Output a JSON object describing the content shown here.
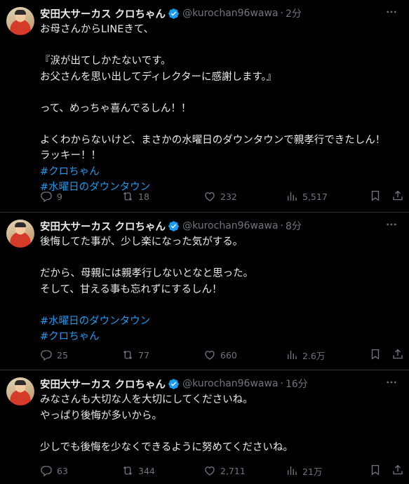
{
  "tweets": [
    {
      "author": "安田大サーカス クロちゃん",
      "handle": "@kurochan96wawa",
      "separator": "·",
      "time": "2分",
      "lines": [
        {
          "text": "お母さんからLINEきて、",
          "type": "text"
        },
        {
          "text": "",
          "type": "blank"
        },
        {
          "text": "『涙が出てしかたないです。",
          "type": "text"
        },
        {
          "text": "お父さんを思い出してディレクターに感謝します。』",
          "type": "text"
        },
        {
          "text": "",
          "type": "blank"
        },
        {
          "text": "って、めっちゃ喜んでるしん！！",
          "type": "text"
        },
        {
          "text": "",
          "type": "blank"
        },
        {
          "text": "よくわからないけど、まさかの水曜日のダウンタウンで親孝行できたしん！",
          "type": "text"
        },
        {
          "text": "ラッキー！！",
          "type": "text"
        },
        {
          "text": "#クロちゃん",
          "type": "hashtag"
        },
        {
          "text": "#水曜日のダウンタウン",
          "type": "hashtag"
        }
      ],
      "replies": "9",
      "retweets": "18",
      "likes": "232",
      "views": "5,517"
    },
    {
      "author": "安田大サーカス クロちゃん",
      "handle": "@kurochan96wawa",
      "separator": "·",
      "time": "8分",
      "lines": [
        {
          "text": "後悔してた事が、少し楽になった気がする。",
          "type": "text"
        },
        {
          "text": "",
          "type": "blank"
        },
        {
          "text": "だから、母親には親孝行しないとなと思った。",
          "type": "text"
        },
        {
          "text": "そして、甘える事も忘れずにするしん！",
          "type": "text"
        },
        {
          "text": "",
          "type": "blank"
        },
        {
          "text": "#水曜日のダウンタウン",
          "type": "hashtag"
        },
        {
          "text": "#クロちゃん",
          "type": "hashtag"
        }
      ],
      "replies": "25",
      "retweets": "77",
      "likes": "660",
      "views": "2.6万"
    },
    {
      "author": "安田大サーカス クロちゃん",
      "handle": "@kurochan96wawa",
      "separator": "·",
      "time": "16分",
      "lines": [
        {
          "text": "みなさんも大切な人を大切にしてくださいね。",
          "type": "text"
        },
        {
          "text": "やっぱり後悔が多いから。",
          "type": "text"
        },
        {
          "text": "",
          "type": "blank"
        },
        {
          "text": "少しでも後悔を少なくできるように努めてくださいね。",
          "type": "text"
        }
      ],
      "replies": "63",
      "retweets": "344",
      "likes": "2,711",
      "views": "21万"
    }
  ],
  "icons": {
    "verified": "verified-badge-icon",
    "more": "more-options-icon",
    "reply": "reply-icon",
    "retweet": "retweet-icon",
    "like": "like-icon",
    "views": "views-icon",
    "bookmark": "bookmark-icon",
    "share": "share-icon"
  },
  "colors": {
    "background": "#000000",
    "text": "#e7e9ea",
    "muted": "#71767b",
    "link": "#1d9bf0",
    "border": "#2f3336"
  }
}
